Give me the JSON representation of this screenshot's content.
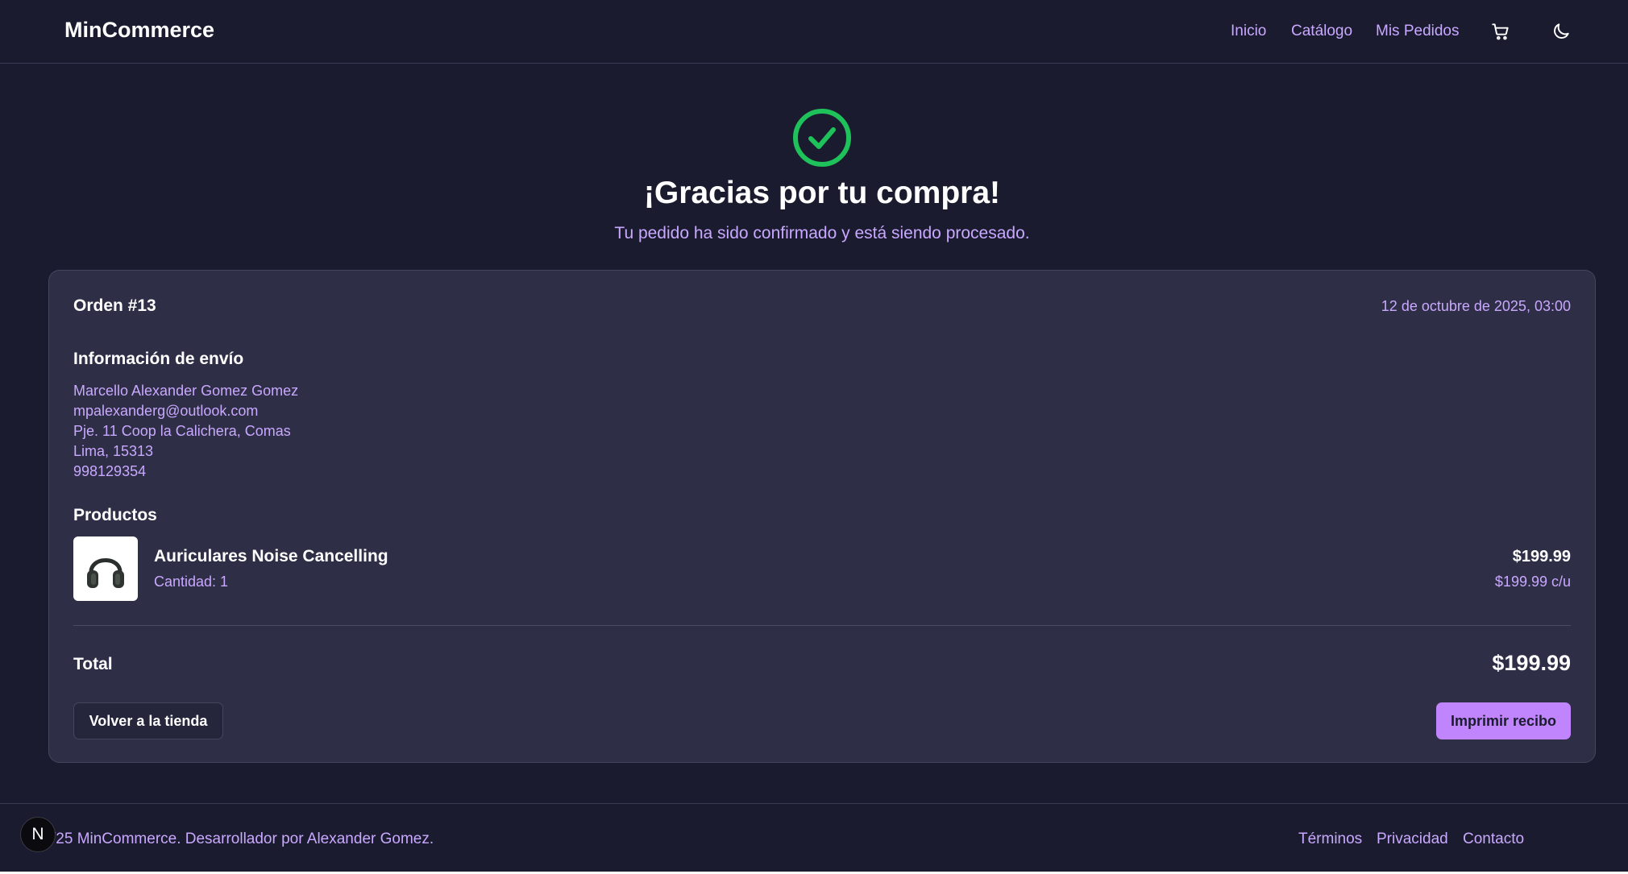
{
  "header": {
    "brand": "MinCommerce",
    "nav": [
      "Inicio",
      "Catálogo",
      "Mis Pedidos"
    ],
    "icons": [
      "cart-icon",
      "moon-icon"
    ]
  },
  "hero": {
    "icon": "check-circle-icon",
    "title": "¡Gracias por tu compra!",
    "subtitle": "Tu pedido ha sido confirmado y está siendo procesado."
  },
  "order": {
    "title": "Orden #13",
    "date": "12 de octubre de 2025, 03:00",
    "shipping_title": "Información de envío",
    "shipping": [
      "Marcello Alexander Gomez Gomez",
      "mpalexanderg@outlook.com",
      "Pje. 11 Coop la Calichera, Comas",
      "Lima, 15313",
      "998129354"
    ],
    "products_title": "Productos",
    "products": [
      {
        "name": "Auriculares Noise Cancelling",
        "quantity": "Cantidad: 1",
        "price": "$199.99",
        "unit_price": "$199.99 c/u",
        "image_icon": "headphones-icon"
      }
    ],
    "total_label": "Total",
    "total_value": "$199.99",
    "back_button": "Volver a la tienda",
    "print_button": "Imprimir recibo"
  },
  "footer": {
    "copyright": "/25 MinCommerce. Desarrollador por Alexander Gomez.",
    "links": [
      "Términos",
      "Privacidad",
      "Contacto"
    ],
    "badge": "N"
  },
  "colors": {
    "background": "#1a1b2e",
    "card": "#2e2e46",
    "accent": "#c084fc",
    "accent_text": "#c9a8ff",
    "success": "#1fc15a"
  }
}
